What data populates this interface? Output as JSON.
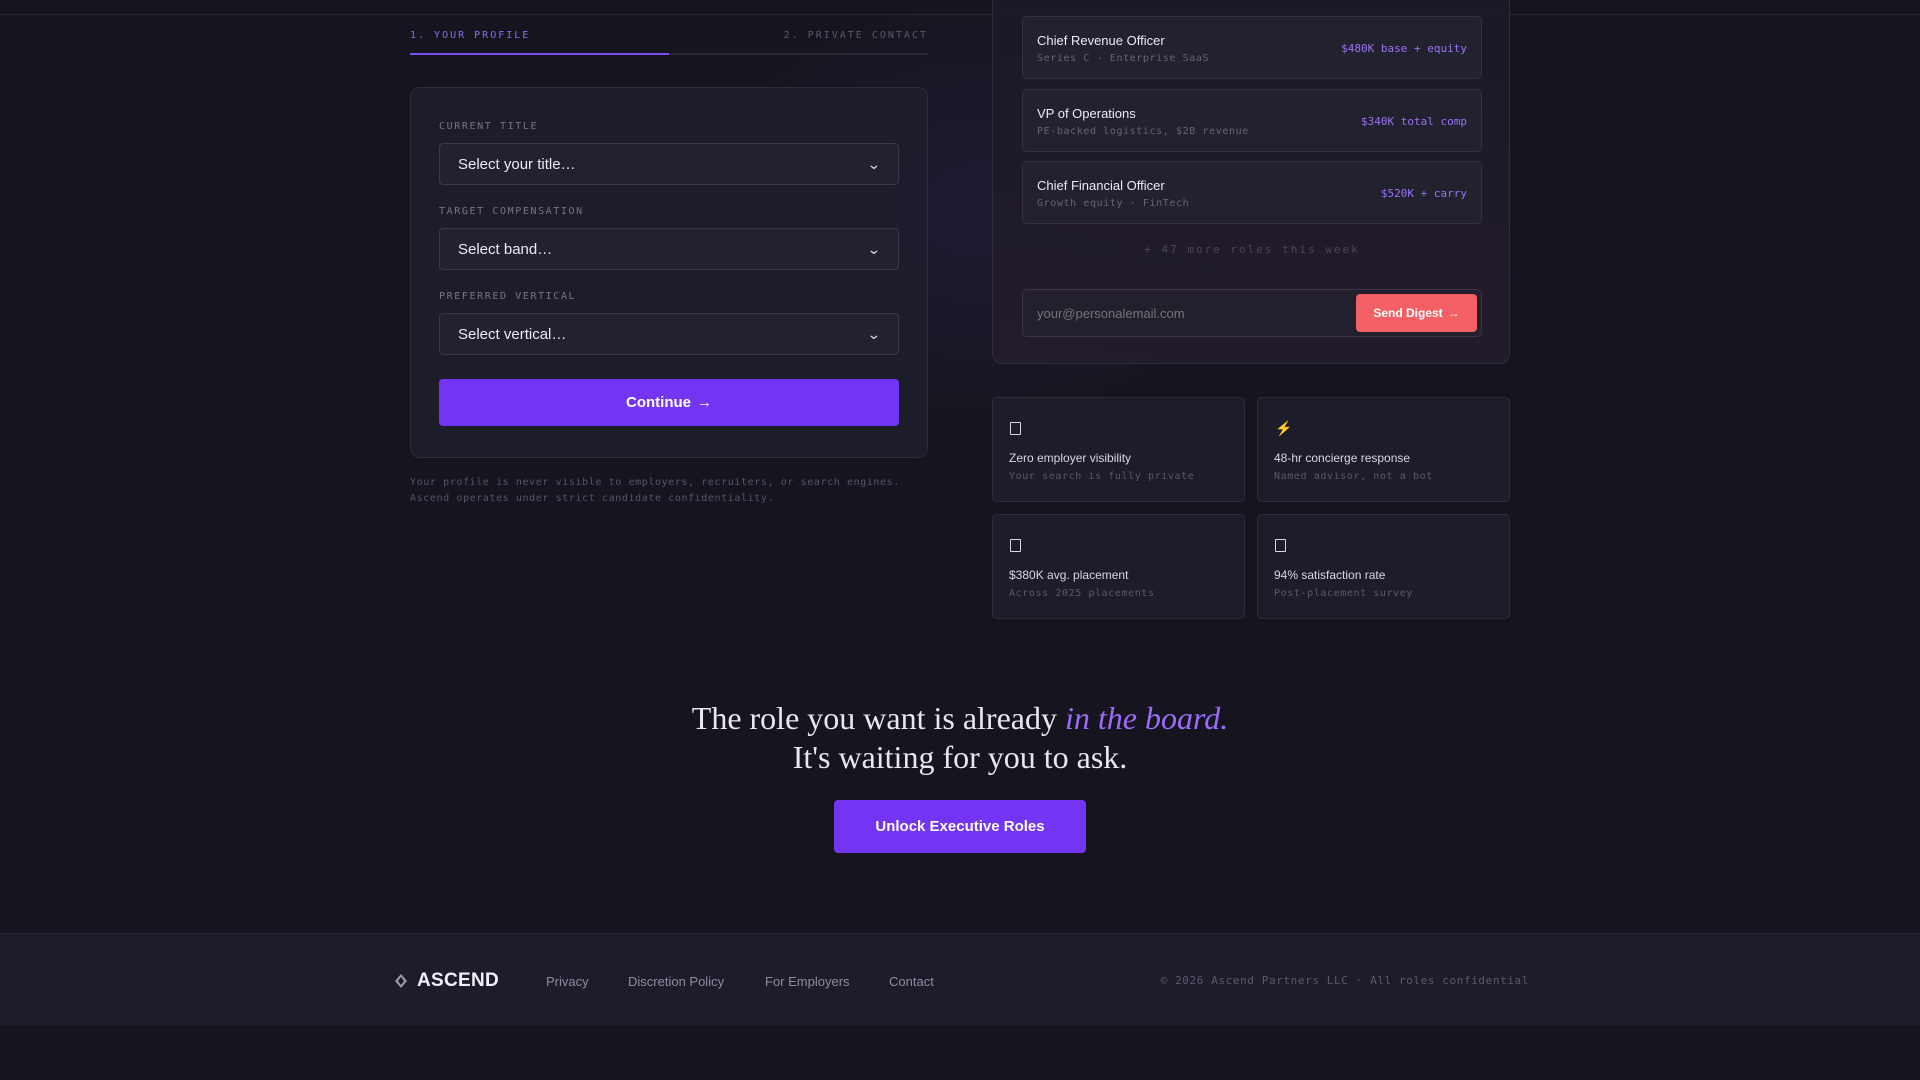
{
  "steps": {
    "step1": "1. YOUR PROFILE",
    "step2": "2. PRIVATE CONTACT",
    "progress_fraction": 0.5
  },
  "form": {
    "fields": [
      {
        "label": "CURRENT TITLE",
        "value": "Select your title…"
      },
      {
        "label": "TARGET COMPENSATION",
        "value": "Select band…"
      },
      {
        "label": "PREFERRED VERTICAL",
        "value": "Select vertical…"
      }
    ],
    "continue_label": "Continue",
    "continue_arrow": "→",
    "privacy_note_line1": "Your profile is never visible to employers, recruiters, or search engines.",
    "privacy_note_line2": "Ascend operates under strict candidate confidentiality."
  },
  "roles": {
    "items": [
      {
        "title": "Chief Revenue Officer",
        "meta": "Series C · Enterprise SaaS",
        "comp": "$480K base + equity"
      },
      {
        "title": "VP of Operations",
        "meta": "PE-backed logistics, $2B revenue",
        "comp": "$340K total comp"
      },
      {
        "title": "Chief Financial Officer",
        "meta": "Growth equity · FinTech",
        "comp": "$520K + carry"
      }
    ],
    "more_text": "+ 47 more roles this week",
    "email_placeholder": "your@personalemail.com",
    "send_label": "Send Digest",
    "send_arrow": "→"
  },
  "features": [
    {
      "icon": "lock-icon",
      "title": "Zero employer visibility",
      "sub": "Your search is fully private"
    },
    {
      "icon": "lightning-icon",
      "glyph": "⚡",
      "title": "48-hr concierge response",
      "sub": "Named advisor, not a bot"
    },
    {
      "icon": "money-icon",
      "title": "$380K avg. placement",
      "sub": "Across 2025 placements"
    },
    {
      "icon": "star-icon",
      "title": "94% satisfaction rate",
      "sub": "Post-placement survey"
    }
  ],
  "cta": {
    "line1_prefix": "The role you want is already ",
    "line1_accent": "in the board.",
    "line2": "It's waiting for you to ask.",
    "button": "Unlock Executive Roles"
  },
  "footer": {
    "brand": "ASCEND",
    "links": [
      "Privacy",
      "Discretion Policy",
      "For Employers",
      "Contact"
    ],
    "copyright": "© 2026 Ascend Partners LLC · All roles confidential"
  },
  "colors": {
    "accent_purple": "#7434f3",
    "accent_coral": "#f26066",
    "background": "#16151f"
  }
}
